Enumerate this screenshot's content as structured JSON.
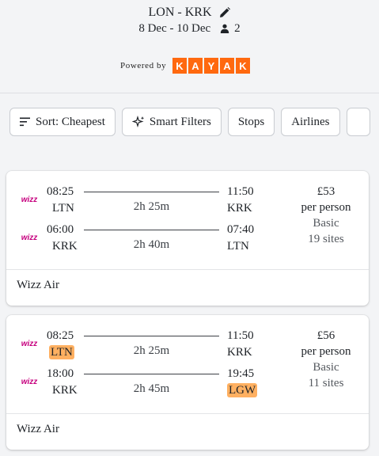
{
  "header": {
    "route": "LON - KRK",
    "dates": "8 Dec - 10 Dec",
    "passengers": "2",
    "powered_by": "Powered by",
    "brand_letters": [
      "K",
      "A",
      "Y",
      "A",
      "K"
    ]
  },
  "filters": [
    {
      "label": "Sort: Cheapest",
      "icon": "sort-icon"
    },
    {
      "label": "Smart Filters",
      "icon": "sparkle-icon"
    },
    {
      "label": "Stops",
      "icon": ""
    },
    {
      "label": "Airlines",
      "icon": ""
    }
  ],
  "colors": {
    "brand": "#ff690f",
    "highlight": "#ffb061",
    "wizz_logo": "#c6007e"
  },
  "results": [
    {
      "legs": [
        {
          "airline_logo": "wizz-air-logo",
          "dep_time": "08:25",
          "dep_code": "LTN",
          "dep_highlight": false,
          "duration": "2h 25m",
          "arr_time": "11:50",
          "arr_code": "KRK",
          "arr_highlight": false
        },
        {
          "airline_logo": "wizz-air-logo",
          "dep_time": "06:00",
          "dep_code": "KRK",
          "dep_highlight": false,
          "duration": "2h 40m",
          "arr_time": "07:40",
          "arr_code": "LTN",
          "arr_highlight": false
        }
      ],
      "price": "£53",
      "per_person": "per person",
      "fare": "Basic",
      "sites": "19 sites",
      "carrier": "Wizz Air"
    },
    {
      "legs": [
        {
          "airline_logo": "wizz-air-logo",
          "dep_time": "08:25",
          "dep_code": "LTN",
          "dep_highlight": true,
          "duration": "2h 25m",
          "arr_time": "11:50",
          "arr_code": "KRK",
          "arr_highlight": false
        },
        {
          "airline_logo": "wizz-air-logo",
          "dep_time": "18:00",
          "dep_code": "KRK",
          "dep_highlight": false,
          "duration": "2h 45m",
          "arr_time": "19:45",
          "arr_code": "LGW",
          "arr_highlight": true
        }
      ],
      "price": "£56",
      "per_person": "per person",
      "fare": "Basic",
      "sites": "11 sites",
      "carrier": "Wizz Air"
    }
  ]
}
